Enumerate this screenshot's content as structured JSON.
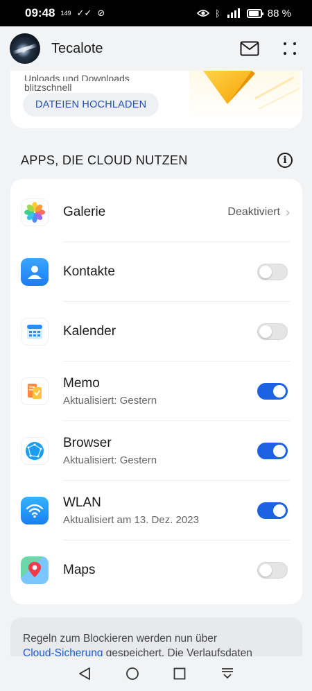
{
  "status_bar": {
    "time": "09:48",
    "extra_small": "149",
    "battery": "88 %"
  },
  "header": {
    "account_name": "Tecalote"
  },
  "upload_card": {
    "text_line1": "Uploads und Downloads",
    "text_line2": "blitzschnell",
    "button_label": "DATEIEN HOCHLADEN"
  },
  "apps_section": {
    "title": "APPS, DIE CLOUD NUTZEN",
    "apps": [
      {
        "name": "Galerie",
        "status": "Deaktiviert",
        "icon": "gallery-icon"
      },
      {
        "name": "Kontakte",
        "toggle": false,
        "icon": "contacts-icon"
      },
      {
        "name": "Kalender",
        "toggle": false,
        "icon": "calendar-icon"
      },
      {
        "name": "Memo",
        "subtitle": "Aktualisiert: Gestern",
        "toggle": true,
        "icon": "memo-icon"
      },
      {
        "name": "Browser",
        "subtitle": "Aktualisiert: Gestern",
        "toggle": true,
        "icon": "browser-icon"
      },
      {
        "name": "WLAN",
        "subtitle": "Aktualisiert am 13. Dez. 2023",
        "toggle": true,
        "icon": "wlan-icon"
      },
      {
        "name": "Maps",
        "toggle": false,
        "icon": "maps-icon"
      }
    ]
  },
  "note": {
    "text_before": "Regeln zum Blockieren werden nun über",
    "link": "Cloud-Sicherung",
    "text_after": " gespeichert. Die Verlaufsdaten"
  },
  "colors": {
    "accent": "#1d62e3",
    "link": "#1a5fd0",
    "background": "#f1f3f5"
  }
}
